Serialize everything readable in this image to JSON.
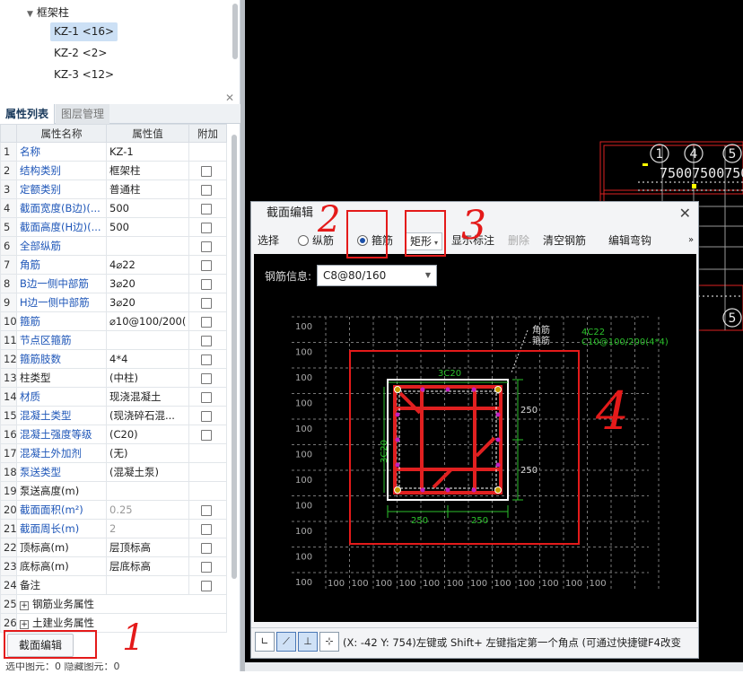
{
  "tree": {
    "parent": "框架柱",
    "items": [
      "KZ-1 <16>",
      "KZ-2 <2>",
      "KZ-3 <12>"
    ]
  },
  "panel": {
    "tab_active": "属性列表",
    "tab_inactive": "图层管理",
    "columns": [
      "属性名称",
      "属性值",
      "附加"
    ]
  },
  "rows": [
    {
      "n": "1",
      "name": "名称",
      "value": "KZ-1",
      "chk": false
    },
    {
      "n": "2",
      "name": "结构类别",
      "value": "框架柱",
      "chk": true
    },
    {
      "n": "3",
      "name": "定额类别",
      "value": "普通柱",
      "chk": true
    },
    {
      "n": "4",
      "name": "截面宽度(B边)(...",
      "value": "500",
      "chk": true
    },
    {
      "n": "5",
      "name": "截面高度(H边)(...",
      "value": "500",
      "chk": true
    },
    {
      "n": "6",
      "name": "全部纵筋",
      "value": "",
      "chk": true
    },
    {
      "n": "7",
      "name": "角筋",
      "value": "4⌀22",
      "chk": true
    },
    {
      "n": "8",
      "name": "B边一侧中部筋",
      "value": "3⌀20",
      "chk": true
    },
    {
      "n": "9",
      "name": "H边一侧中部筋",
      "value": "3⌀20",
      "chk": true
    },
    {
      "n": "10",
      "name": "箍筋",
      "value": "⌀10@100/200(",
      "chk": true
    },
    {
      "n": "11",
      "name": "节点区箍筋",
      "value": "",
      "chk": true
    },
    {
      "n": "12",
      "name": "箍筋肢数",
      "value": "4*4",
      "chk": true
    },
    {
      "n": "13",
      "name": "柱类型",
      "value": "(中柱)",
      "chk": true
    },
    {
      "n": "14",
      "name": "材质",
      "value": "现浇混凝土",
      "chk": true
    },
    {
      "n": "15",
      "name": "混凝土类型",
      "value": "(现浇碎石混...",
      "chk": true
    },
    {
      "n": "16",
      "name": "混凝土强度等级",
      "value": "(C20)",
      "chk": true
    },
    {
      "n": "17",
      "name": "混凝土外加剂",
      "value": "(无)",
      "chk": false
    },
    {
      "n": "18",
      "name": "泵送类型",
      "value": "(混凝土泵)",
      "chk": false
    },
    {
      "n": "19",
      "name": "泵送高度(m)",
      "value": "",
      "chk": false
    },
    {
      "n": "20",
      "name": "截面面积(m²)",
      "value": "0.25",
      "chk": true
    },
    {
      "n": "21",
      "name": "截面周长(m)",
      "value": "2",
      "chk": true
    },
    {
      "n": "22",
      "name": "顶标高(m)",
      "value": "层顶标高",
      "chk": true
    },
    {
      "n": "23",
      "name": "底标高(m)",
      "value": "层底标高",
      "chk": true
    },
    {
      "n": "24",
      "name": "备注",
      "value": "",
      "chk": true
    }
  ],
  "groups": [
    "钢筋业务属性",
    "土建业务属性"
  ],
  "bottom_button": "截面编辑",
  "status_left": "选中图元：0    隐藏图元：0",
  "dialog": {
    "title": "截面编辑",
    "toolbar": {
      "select": "选择",
      "radio_long": "纵筋",
      "radio_stirrup": "箍筋",
      "shape": "矩形",
      "show_mark": "显示标注",
      "delete": "删除",
      "clear": "清空钢筋",
      "edit_hook": "编辑弯钩"
    },
    "info_label": "钢筋信息:",
    "info_value": "C8@80/160",
    "status": "(X: -42 Y: 754)左键或 Shift+ 左键指定第一个角点 (可通过快捷键F4改变"
  },
  "section": {
    "top_callout_lines": [
      "角筋",
      "箍筋"
    ],
    "green_info": [
      "4C22",
      "C10@100/200(4*4)"
    ],
    "top_label": "3C20",
    "side_label": "3C20",
    "dim_right": [
      "250",
      "250"
    ],
    "dim_bottom": [
      "250",
      "250"
    ],
    "grid_label": "100"
  },
  "annotations": [
    "1",
    "2",
    "3",
    "4"
  ],
  "cad_numbers": [
    "1",
    "4",
    "5",
    "5"
  ],
  "cad_text": "75007500750"
}
